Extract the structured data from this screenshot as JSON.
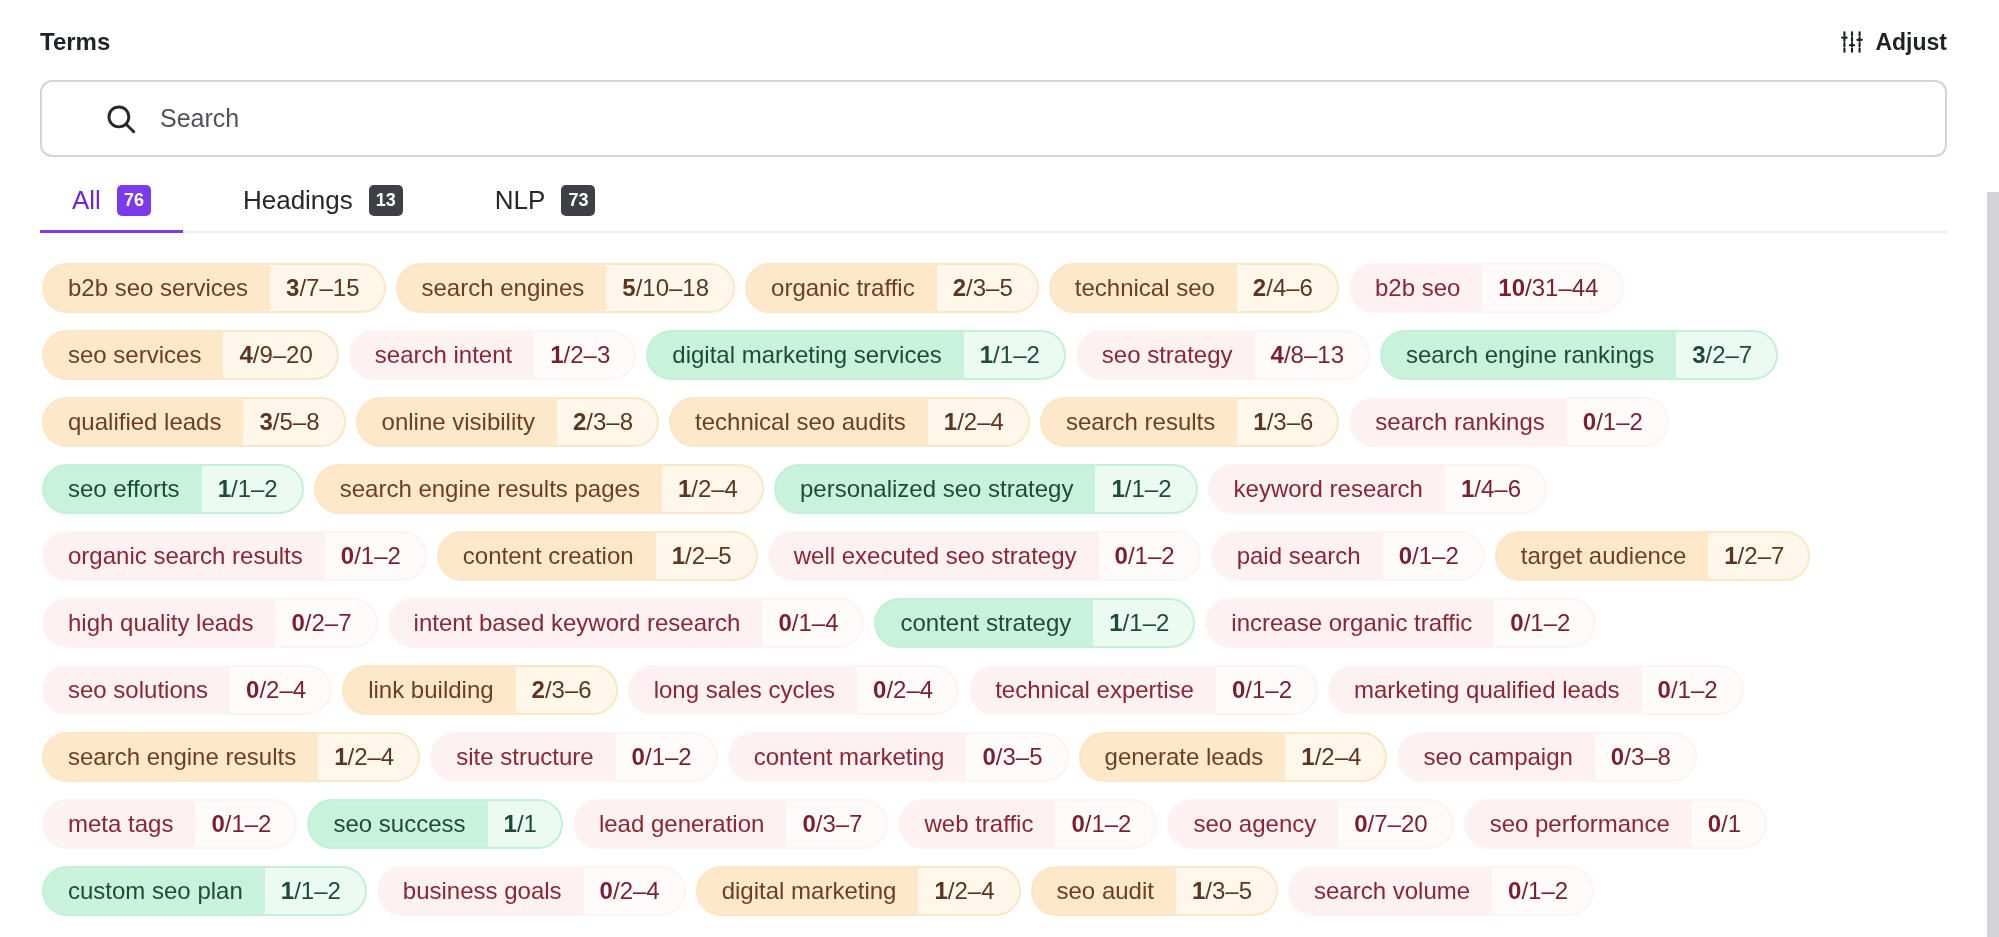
{
  "header": {
    "title": "Terms",
    "adjust_label": "Adjust"
  },
  "search": {
    "placeholder": "Search"
  },
  "tabs": [
    {
      "label": "All",
      "count": "76",
      "selected": true
    },
    {
      "label": "Headings",
      "count": "13",
      "selected": false
    },
    {
      "label": "NLP",
      "count": "73",
      "selected": false
    }
  ],
  "term_rows": [
    [
      {
        "name": "b2b seo services",
        "count": "**3**/7–15",
        "kind": "partial"
      },
      {
        "name": "search engines",
        "count": "**5**/10–18",
        "kind": "partial"
      },
      {
        "name": "organic traffic",
        "count": "**2**/3–5",
        "kind": "partial"
      },
      {
        "name": "technical seo",
        "count": "**2**/4–6",
        "kind": "partial"
      },
      {
        "name": "b2b seo",
        "count": "**10**/31–44",
        "kind": "missing"
      }
    ],
    [
      {
        "name": "seo services",
        "count": "**4**/9–20",
        "kind": "partial"
      },
      {
        "name": "search intent",
        "count": "**1**/2–3",
        "kind": "missing"
      },
      {
        "name": "digital marketing services",
        "count": "**1**/1–2",
        "kind": "done"
      },
      {
        "name": "seo strategy",
        "count": "**4**/8–13",
        "kind": "missing"
      },
      {
        "name": "search engine rankings",
        "count": "**3**/2–7",
        "kind": "done"
      }
    ],
    [
      {
        "name": "qualified leads",
        "count": "**3**/5–8",
        "kind": "partial"
      },
      {
        "name": "online visibility",
        "count": "**2**/3–8",
        "kind": "partial"
      },
      {
        "name": "technical seo audits",
        "count": "**1**/2–4",
        "kind": "partial"
      },
      {
        "name": "search results",
        "count": "**1**/3–6",
        "kind": "partial"
      },
      {
        "name": "search rankings",
        "count": "**0**/1–2",
        "kind": "missing"
      }
    ],
    [
      {
        "name": "seo efforts",
        "count": "**1**/1–2",
        "kind": "done"
      },
      {
        "name": "search engine results pages",
        "count": "**1**/2–4",
        "kind": "partial"
      },
      {
        "name": "personalized seo strategy",
        "count": "**1**/1–2",
        "kind": "done"
      },
      {
        "name": "keyword research",
        "count": "**1**/4–6",
        "kind": "missing"
      }
    ],
    [
      {
        "name": "organic search results",
        "count": "**0**/1–2",
        "kind": "missing"
      },
      {
        "name": "content creation",
        "count": "**1**/2–5",
        "kind": "partial"
      },
      {
        "name": "well executed seo strategy",
        "count": "**0**/1–2",
        "kind": "missing"
      },
      {
        "name": "paid search",
        "count": "**0**/1–2",
        "kind": "missing"
      },
      {
        "name": "target audience",
        "count": "**1**/2–7",
        "kind": "partial"
      }
    ],
    [
      {
        "name": "high quality leads",
        "count": "**0**/2–7",
        "kind": "missing"
      },
      {
        "name": "intent based keyword research",
        "count": "**0**/1–4",
        "kind": "missing"
      },
      {
        "name": "content strategy",
        "count": "**1**/1–2",
        "kind": "done"
      },
      {
        "name": "increase organic traffic",
        "count": "**0**/1–2",
        "kind": "missing"
      }
    ],
    [
      {
        "name": "seo solutions",
        "count": "**0**/2–4",
        "kind": "missing"
      },
      {
        "name": "link building",
        "count": "**2**/3–6",
        "kind": "partial"
      },
      {
        "name": "long sales cycles",
        "count": "**0**/2–4",
        "kind": "missing"
      },
      {
        "name": "technical expertise",
        "count": "**0**/1–2",
        "kind": "missing"
      },
      {
        "name": "marketing qualified leads",
        "count": "**0**/1–2",
        "kind": "missing"
      }
    ],
    [
      {
        "name": "search engine results",
        "count": "**1**/2–4",
        "kind": "partial"
      },
      {
        "name": "site structure",
        "count": "**0**/1–2",
        "kind": "missing"
      },
      {
        "name": "content marketing",
        "count": "**0**/3–5",
        "kind": "missing"
      },
      {
        "name": "generate leads",
        "count": "**1**/2–4",
        "kind": "partial"
      },
      {
        "name": "seo campaign",
        "count": "**0**/3–8",
        "kind": "missing"
      }
    ],
    [
      {
        "name": "meta tags",
        "count": "**0**/1–2",
        "kind": "missing"
      },
      {
        "name": "seo success",
        "count": "**1**/1",
        "kind": "done"
      },
      {
        "name": "lead generation",
        "count": "**0**/3–7",
        "kind": "missing"
      },
      {
        "name": "web traffic",
        "count": "**0**/1–2",
        "kind": "missing"
      },
      {
        "name": "seo agency",
        "count": "**0**/7–20",
        "kind": "missing"
      },
      {
        "name": "seo performance",
        "count": "**0**/1",
        "kind": "missing"
      }
    ],
    [
      {
        "name": "custom seo plan",
        "count": "**1**/1–2",
        "kind": "done"
      },
      {
        "name": "business goals",
        "count": "**0**/2–4",
        "kind": "missing"
      },
      {
        "name": "digital marketing",
        "count": "**1**/2–4",
        "kind": "partial"
      },
      {
        "name": "seo audit",
        "count": "**1**/3–5",
        "kind": "partial"
      },
      {
        "name": "search volume",
        "count": "**0**/1–2",
        "kind": "missing"
      }
    ]
  ]
}
